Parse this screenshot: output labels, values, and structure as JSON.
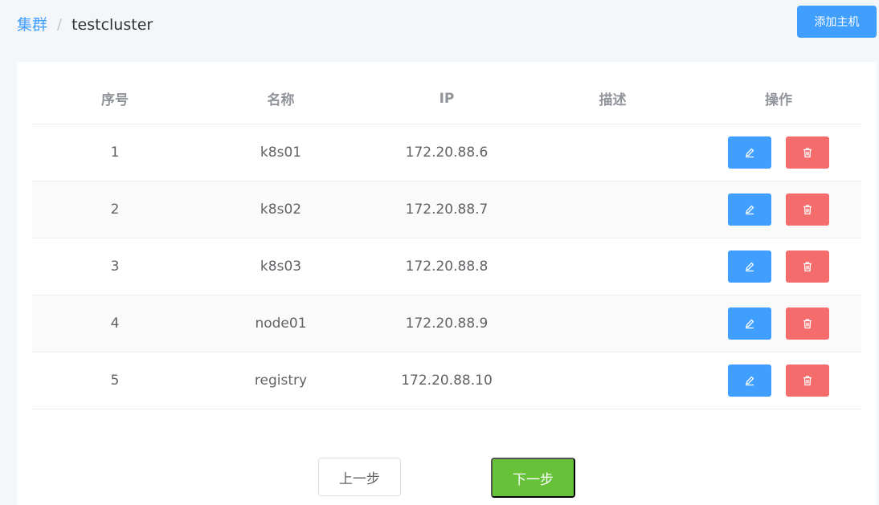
{
  "breadcrumb": {
    "root": "集群",
    "separator": "/",
    "current": "testcluster"
  },
  "toolbar": {
    "add_host_label": "添加主机"
  },
  "table": {
    "columns": [
      "序号",
      "名称",
      "IP",
      "描述",
      "操作"
    ],
    "rows": [
      {
        "index": "1",
        "name": "k8s01",
        "ip": "172.20.88.6",
        "desc": ""
      },
      {
        "index": "2",
        "name": "k8s02",
        "ip": "172.20.88.7",
        "desc": ""
      },
      {
        "index": "3",
        "name": "k8s03",
        "ip": "172.20.88.8",
        "desc": ""
      },
      {
        "index": "4",
        "name": "node01",
        "ip": "172.20.88.9",
        "desc": ""
      },
      {
        "index": "5",
        "name": "registry",
        "ip": "172.20.88.10",
        "desc": ""
      }
    ]
  },
  "footer": {
    "prev_label": "上一步",
    "next_label": "下一步"
  },
  "colors": {
    "primary": "#409eff",
    "danger": "#f56c6c",
    "success": "#67c23a"
  },
  "icons": {
    "edit": "edit-icon",
    "delete": "trash-icon"
  }
}
